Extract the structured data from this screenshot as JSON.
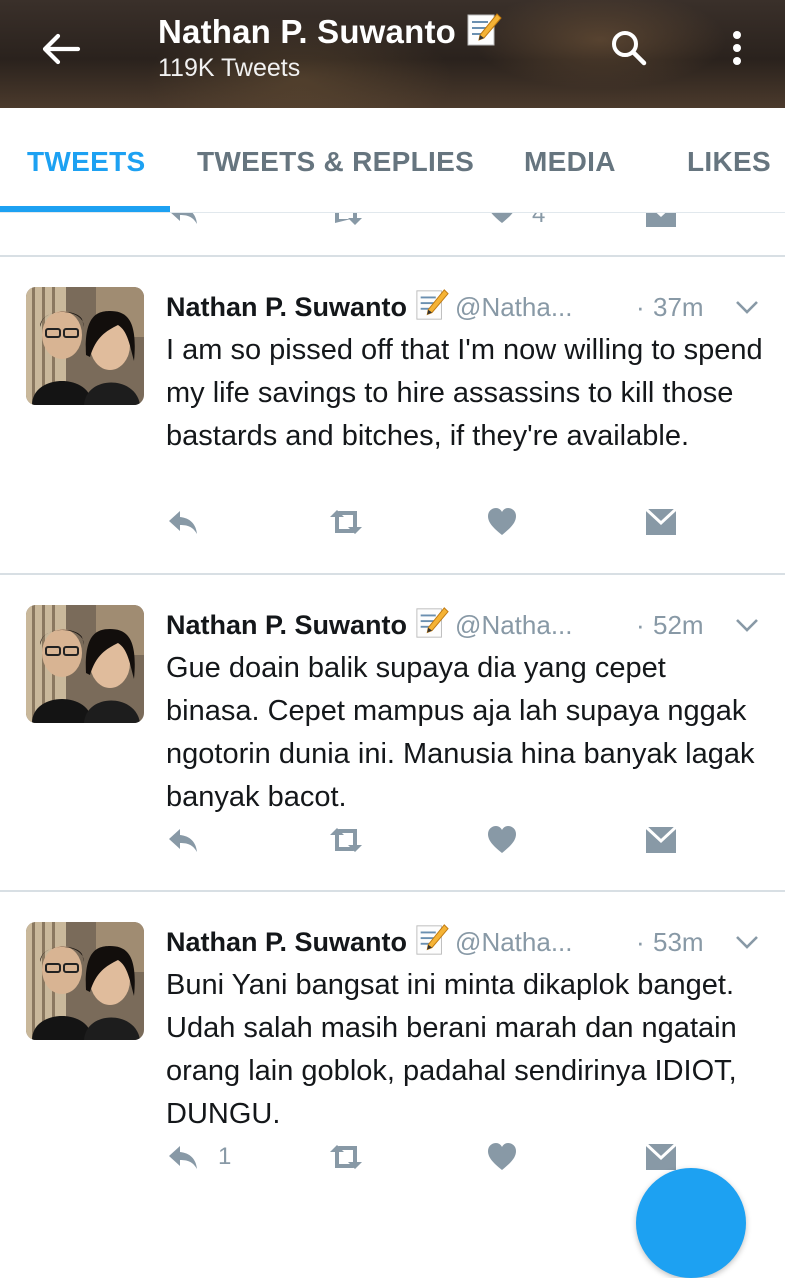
{
  "header": {
    "title": "Nathan P. Suwanto",
    "subtitle": "119K Tweets",
    "icons": [
      "back-arrow-icon",
      "memo-icon",
      "search-icon",
      "more-vert-icon"
    ]
  },
  "tabs": [
    {
      "label": "TWEETS",
      "active": true
    },
    {
      "label": "TWEETS & REPLIES",
      "active": false
    },
    {
      "label": "MEDIA",
      "active": false
    },
    {
      "label": "LIKES",
      "active": false
    }
  ],
  "partial_tweet": {
    "like_count": "4"
  },
  "tweets": [
    {
      "name": "Nathan P. Suwanto",
      "handle": "@Natha...",
      "time": "37m",
      "text": "I am so pissed off that I'm now willing to spend my life savings to hire assassins to kill those bastards and bitches, if they're available.",
      "reply_count": ""
    },
    {
      "name": "Nathan P. Suwanto",
      "handle": "@Natha...",
      "time": "52m",
      "text": "Gue doain balik supaya dia yang cepet binasa. Cepet mampus aja lah supaya nggak ngotorin dunia ini. Manusia hina banyak lagak banyak bacot.",
      "reply_count": ""
    },
    {
      "name": "Nathan P. Suwanto",
      "handle": "@Natha...",
      "time": "53m",
      "text": "Buni Yani bangsat ini minta dikaplok banget. Udah salah masih berani marah dan ngatain orang lain goblok, padahal sendirinya IDIOT, DUNGU.",
      "reply_count": "1"
    }
  ],
  "colors": {
    "accent": "#1da1f2",
    "text": "#14171a",
    "muted": "#8899a6",
    "divider": "#d8dfe4"
  }
}
